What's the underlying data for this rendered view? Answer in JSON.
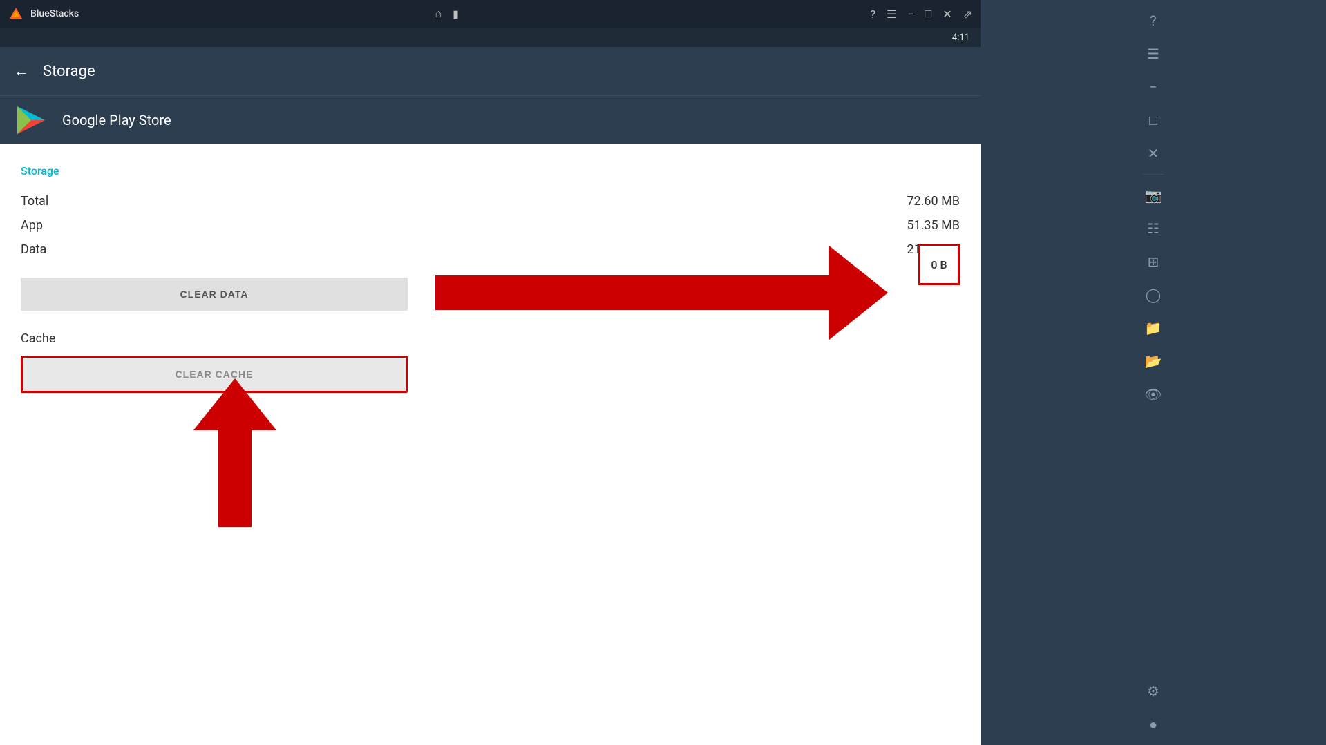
{
  "titleBar": {
    "appName": "BlueStacks",
    "icons": [
      "home",
      "layers"
    ]
  },
  "clock": {
    "time": "4:11"
  },
  "appHeader": {
    "title": "Storage",
    "backLabel": "←"
  },
  "appInfo": {
    "appName": "Google Play Store"
  },
  "storage": {
    "sectionTitle": "Storage",
    "rows": [
      {
        "label": "Total",
        "value": "72.60 MB"
      },
      {
        "label": "App",
        "value": "51.35 MB"
      },
      {
        "label": "Data",
        "value": "21.25 MB"
      }
    ],
    "clearDataLabel": "CLEAR DATA",
    "cacheLabel": "Cache",
    "cacheValue": "0 B",
    "clearCacheLabel": "CLEAR CACHE"
  },
  "sidebar": {
    "icons": [
      "question-circle",
      "menu",
      "minus",
      "square",
      "close",
      "expand",
      "camera",
      "table",
      "table-alt",
      "circle-user",
      "folder",
      "folder-alt",
      "eye",
      "gear",
      "settings-alt"
    ]
  }
}
